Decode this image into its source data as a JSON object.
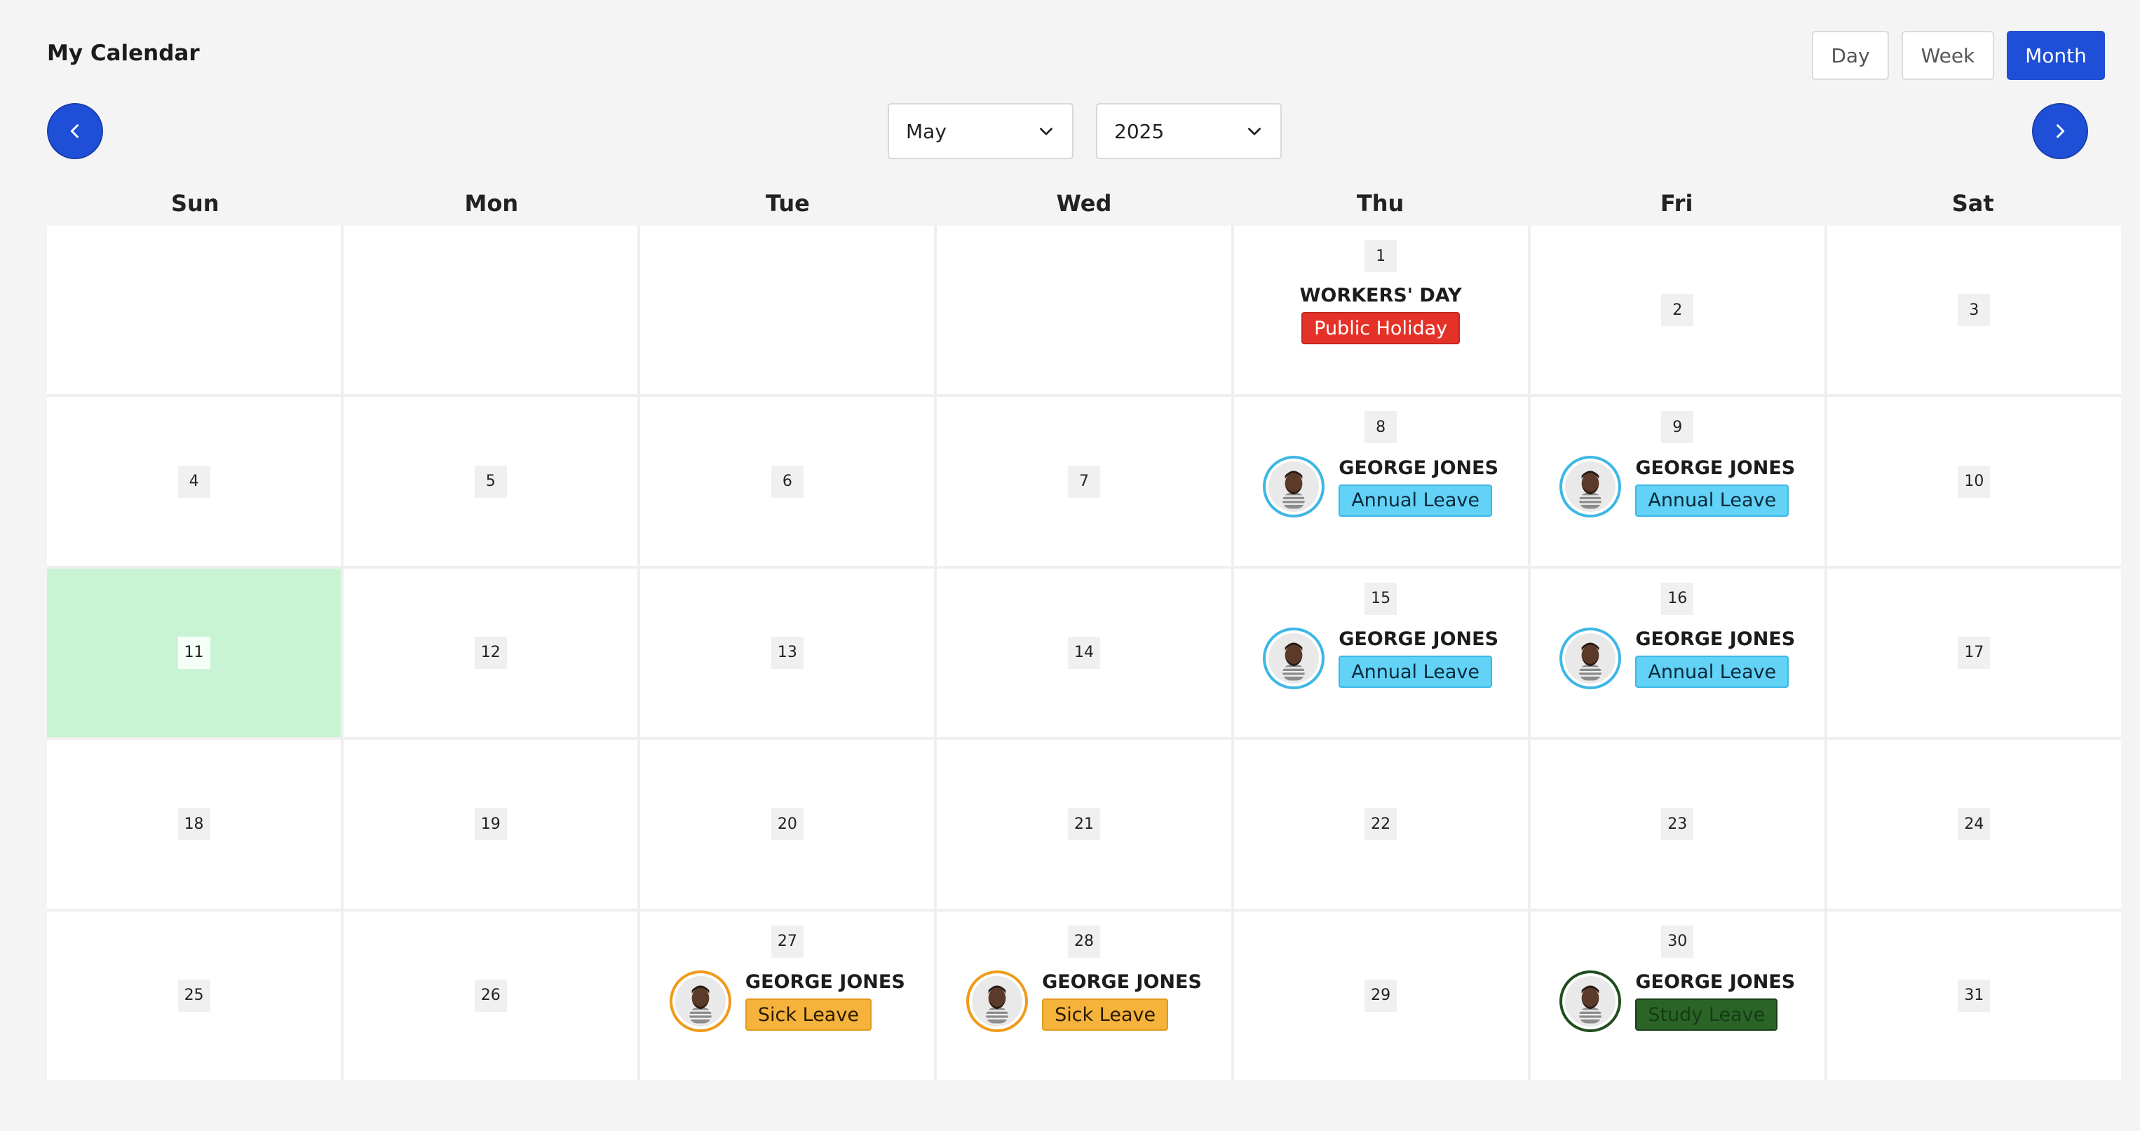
{
  "header": {
    "title": "My Calendar"
  },
  "views": {
    "day": "Day",
    "week": "Week",
    "month": "Month",
    "active": "Month"
  },
  "selectors": {
    "month": "May",
    "year": "2025"
  },
  "weekdays": [
    "Sun",
    "Mon",
    "Tue",
    "Wed",
    "Thu",
    "Fri",
    "Sat"
  ],
  "colors": {
    "accent": "#1e4fd6",
    "today": "#c8f4d4",
    "public_holiday": "#e53228",
    "annual_leave": "#62d2f7",
    "sick_leave": "#f6b33b",
    "study_leave": "#2a6427"
  },
  "calendar": {
    "today": "11",
    "cells": [
      {
        "date": ""
      },
      {
        "date": ""
      },
      {
        "date": ""
      },
      {
        "date": ""
      },
      {
        "date": "1",
        "holiday": {
          "name": "WORKERS' DAY",
          "label": "Public Holiday"
        }
      },
      {
        "date": "2"
      },
      {
        "date": "3"
      },
      {
        "date": "4"
      },
      {
        "date": "5"
      },
      {
        "date": "6"
      },
      {
        "date": "7"
      },
      {
        "date": "8",
        "leave": {
          "name": "GEORGE JONES",
          "type": "Annual Leave",
          "kind": "annual"
        }
      },
      {
        "date": "9",
        "leave": {
          "name": "GEORGE JONES",
          "type": "Annual Leave",
          "kind": "annual"
        }
      },
      {
        "date": "10"
      },
      {
        "date": "11"
      },
      {
        "date": "12"
      },
      {
        "date": "13"
      },
      {
        "date": "14"
      },
      {
        "date": "15",
        "leave": {
          "name": "GEORGE JONES",
          "type": "Annual Leave",
          "kind": "annual"
        }
      },
      {
        "date": "16",
        "leave": {
          "name": "GEORGE JONES",
          "type": "Annual Leave",
          "kind": "annual"
        }
      },
      {
        "date": "17"
      },
      {
        "date": "18"
      },
      {
        "date": "19"
      },
      {
        "date": "20"
      },
      {
        "date": "21"
      },
      {
        "date": "22"
      },
      {
        "date": "23"
      },
      {
        "date": "24"
      },
      {
        "date": "25"
      },
      {
        "date": "26"
      },
      {
        "date": "27",
        "leave": {
          "name": "GEORGE JONES",
          "type": "Sick Leave",
          "kind": "sick"
        }
      },
      {
        "date": "28",
        "leave": {
          "name": "GEORGE JONES",
          "type": "Sick Leave",
          "kind": "sick"
        }
      },
      {
        "date": "29"
      },
      {
        "date": "30",
        "leave": {
          "name": "GEORGE JONES",
          "type": "Study Leave",
          "kind": "study"
        }
      },
      {
        "date": "31"
      }
    ]
  },
  "icons": {
    "prev": "chevron-left-icon",
    "next": "chevron-right-icon",
    "dropdown": "chevron-down-icon",
    "avatar": "user-avatar-icon"
  }
}
